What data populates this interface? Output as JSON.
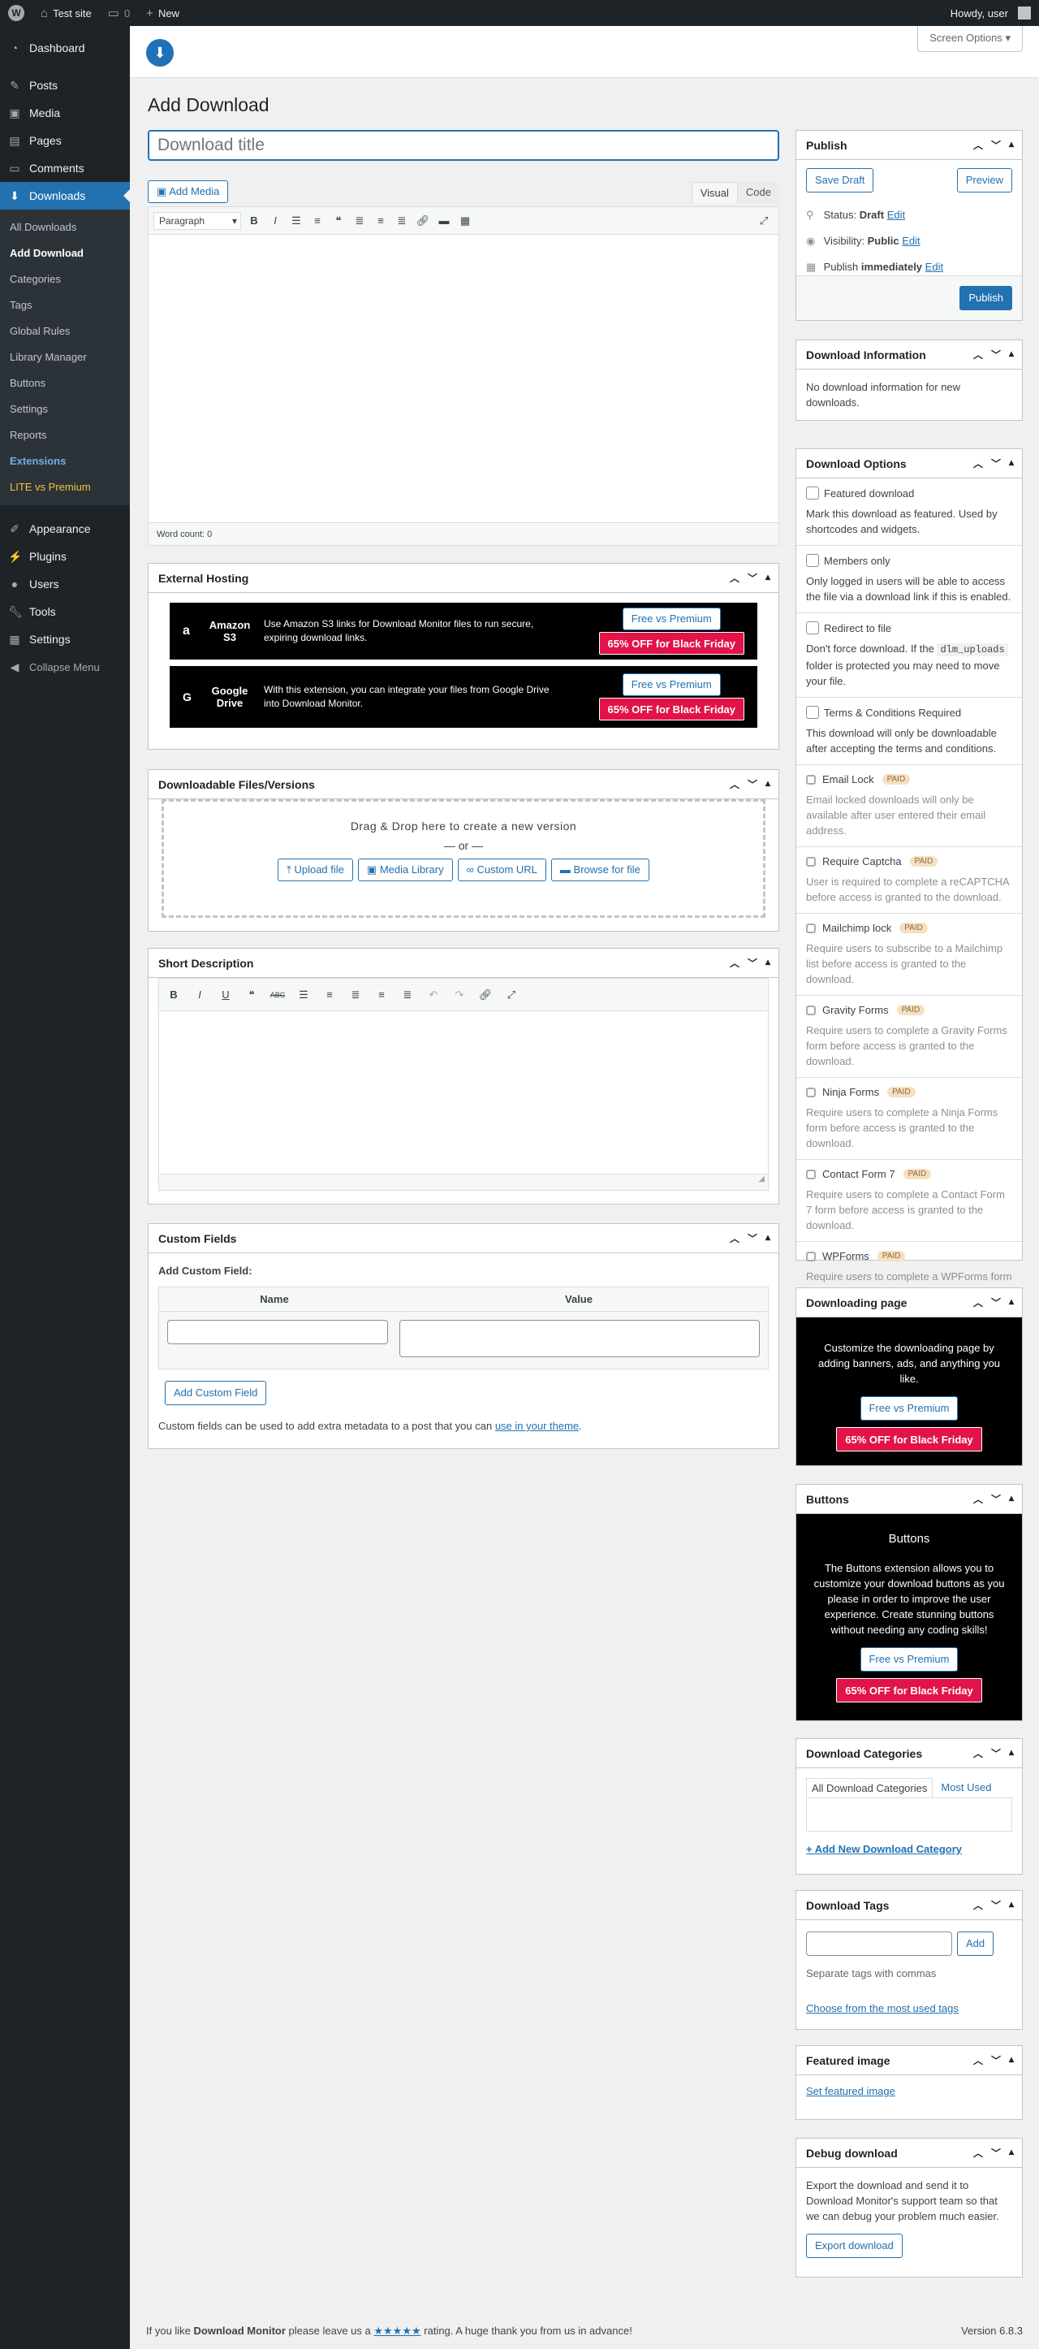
{
  "adminbar": {
    "site": "Test site",
    "comments": "0",
    "new": "New",
    "howdy": "Howdy, user"
  },
  "menu": {
    "dashboard": "Dashboard",
    "posts": "Posts",
    "media": "Media",
    "pages": "Pages",
    "comments": "Comments",
    "downloads": "Downloads",
    "sub": [
      "All Downloads",
      "Add Download",
      "Categories",
      "Tags",
      "Global Rules",
      "Library Manager",
      "Buttons",
      "Settings",
      "Reports",
      "Extensions",
      "LITE vs Premium"
    ],
    "appearance": "Appearance",
    "plugins": "Plugins",
    "users": "Users",
    "tools": "Tools",
    "settings": "Settings",
    "collapse": "Collapse Menu"
  },
  "screen_options": "Screen Options ▾",
  "page_title": "Add Download",
  "title_placeholder": "Download title",
  "editor": {
    "add_media": "Add Media",
    "visual": "Visual",
    "code": "Code",
    "format": "Paragraph",
    "word_count": "Word count: 0"
  },
  "external_hosting": {
    "title": "External Hosting",
    "items": [
      {
        "name": "Amazon S3",
        "desc": "Use Amazon S3 links for Download Monitor files to run secure, expiring download links.",
        "free": "Free vs Premium",
        "offer": "65% OFF for Black Friday"
      },
      {
        "name": "Google Drive",
        "desc": "With this extension, you can integrate your files from Google Drive into Download Monitor.",
        "free": "Free vs Premium",
        "offer": "65% OFF for Black Friday"
      }
    ]
  },
  "files": {
    "title": "Downloadable Files/Versions",
    "drag": "Drag & Drop here to create a new version",
    "or": "— or —",
    "buttons": [
      "Upload file",
      "Media Library",
      "Custom URL",
      "Browse for file"
    ]
  },
  "short_desc": {
    "title": "Short Description"
  },
  "custom_fields": {
    "title": "Custom Fields",
    "add_label": "Add Custom Field:",
    "col_name": "Name",
    "col_value": "Value",
    "button": "Add Custom Field",
    "note": "Custom fields can be used to add extra metadata to a post that you can",
    "note_link": "use in your theme",
    "note_end": "."
  },
  "publish": {
    "title": "Publish",
    "save_draft": "Save Draft",
    "preview": "Preview",
    "status_label": "Status:",
    "status": "Draft",
    "visibility_label": "Visibility:",
    "visibility": "Public",
    "publish_label": "Publish",
    "publish_when": "immediately",
    "edit": "Edit",
    "button": "Publish"
  },
  "download_info": {
    "title": "Download Information",
    "text": "No download information for new downloads."
  },
  "download_options": {
    "title": "Download Options",
    "options": [
      {
        "label": "Featured download",
        "desc": "Mark this download as featured. Used by shortcodes and widgets."
      },
      {
        "label": "Members only",
        "desc": "Only logged in users will be able to access the file via a download link if this is enabled."
      },
      {
        "label": "Redirect to file",
        "desc1": "Don't force download. If the",
        "code": "dlm_uploads",
        "desc2": "folder is protected you may need to move your file."
      },
      {
        "label": "Terms & Conditions Required",
        "desc": "This download will only be downloadable after accepting the terms and conditions."
      }
    ],
    "paid_badge": "PAID",
    "paid": [
      {
        "label": "Email Lock",
        "desc": "Email locked downloads will only be available after user entered their email address."
      },
      {
        "label": "Require Captcha",
        "desc": "User is required to complete a reCAPTCHA before access is granted to the download."
      },
      {
        "label": "Mailchimp lock",
        "desc": "Require users to subscribe to a Mailchimp list before access is granted to the download."
      },
      {
        "label": "Gravity Forms",
        "desc": "Require users to complete a Gravity Forms form before access is granted to the download."
      },
      {
        "label": "Ninja Forms",
        "desc": "Require users to complete a Ninja Forms form before access is granted to the download."
      },
      {
        "label": "Contact Form 7",
        "desc": "Require users to complete a Contact Form 7 form before access is granted to the download."
      },
      {
        "label": "WPForms",
        "desc": "Require users to complete a WPForms form before access is granted to the download."
      }
    ]
  },
  "downloading_page": {
    "title": "Downloading page",
    "text": "Customize the downloading page by adding banners, ads, and anything you like.",
    "free": "Free vs Premium",
    "offer": "65% OFF for Black Friday"
  },
  "buttons_box": {
    "title": "Buttons",
    "heading": "Buttons",
    "text": "The Buttons extension allows you to customize your download buttons as you please in order to improve the user experience. Create stunning buttons without needing any coding skills!",
    "free": "Free vs Premium",
    "offer": "65% OFF for Black Friday"
  },
  "categories": {
    "title": "Download Categories",
    "tab_all": "All Download Categories",
    "tab_used": "Most Used",
    "add": "+ Add New Download Category"
  },
  "tags": {
    "title": "Download Tags",
    "add": "Add",
    "hint": "Separate tags with commas",
    "choose": "Choose from the most used tags"
  },
  "featured_image": {
    "title": "Featured image",
    "link": "Set featured image"
  },
  "debug": {
    "title": "Debug download",
    "text": "Export the download and send it to Download Monitor's support team so that we can debug your problem much easier.",
    "button": "Export download"
  },
  "footer": {
    "pre": "If you like",
    "brand": "Download Monitor",
    "mid": "please leave us a",
    "stars": "★★★★★",
    "post": "rating. A huge thank you from us in advance!",
    "version": "Version 6.8.3"
  }
}
